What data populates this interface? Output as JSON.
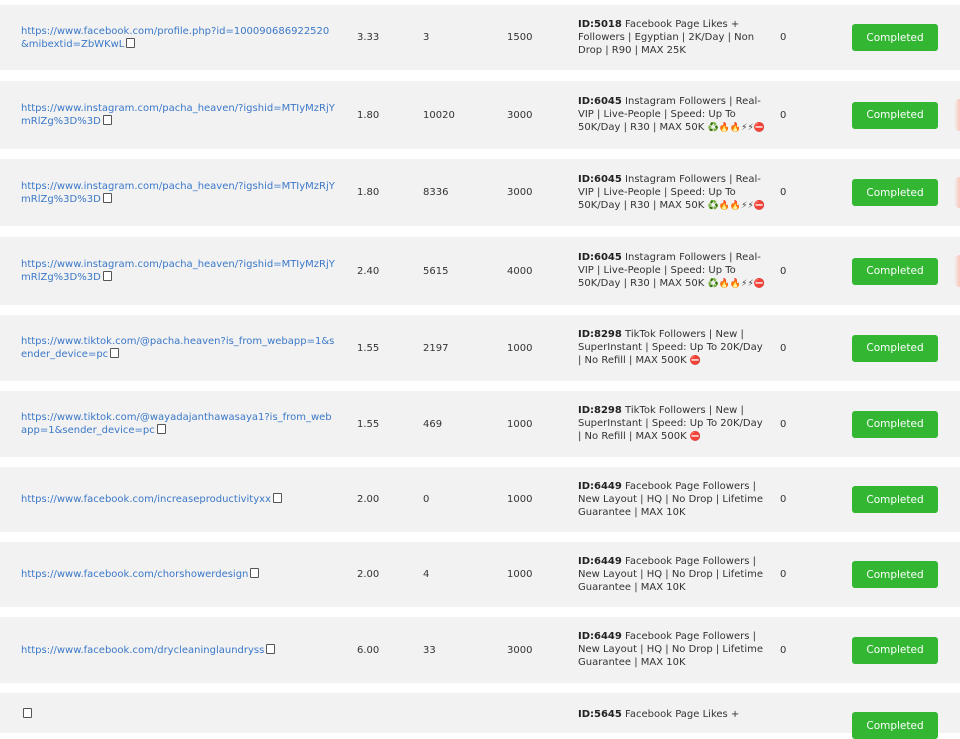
{
  "orders": [
    {
      "link": "https://www.facebook.com/profile.php?id=100090686922520&mibextid=ZbWKwL",
      "charge": "3.33",
      "start_count": "3",
      "quantity": "1500",
      "service_id": "ID:5018",
      "service": "Facebook Page Likes + Followers | Egyptian | 2K/Day | Non Drop | R90 | MAX 25K",
      "service_emoji": "",
      "remains": "0",
      "status": "Completed"
    },
    {
      "link": "https://www.instagram.com/pacha_heaven/?igshid=MTIyMzRjYmRlZg%3D%3D",
      "charge": "1.80",
      "start_count": "10020",
      "quantity": "3000",
      "service_id": "ID:6045",
      "service": "Instagram Followers | Real-VIP | Live-People | Speed: Up To 50K/Day | R30 | MAX 50K",
      "service_emoji": "♻️🔥🔥⚡⚡⛔",
      "remains": "0",
      "status": "Completed"
    },
    {
      "link": "https://www.instagram.com/pacha_heaven/?igshid=MTIyMzRjYmRlZg%3D%3D",
      "charge": "1.80",
      "start_count": "8336",
      "quantity": "3000",
      "service_id": "ID:6045",
      "service": "Instagram Followers | Real-VIP | Live-People | Speed: Up To 50K/Day | R30 | MAX 50K",
      "service_emoji": "♻️🔥🔥⚡⚡⛔",
      "remains": "0",
      "status": "Completed"
    },
    {
      "link": "https://www.instagram.com/pacha_heaven/?igshid=MTIyMzRjYmRlZg%3D%3D",
      "charge": "2.40",
      "start_count": "5615",
      "quantity": "4000",
      "service_id": "ID:6045",
      "service": "Instagram Followers | Real-VIP | Live-People | Speed: Up To 50K/Day | R30 | MAX 50K",
      "service_emoji": "♻️🔥🔥⚡⚡⛔",
      "remains": "0",
      "status": "Completed"
    },
    {
      "link": "https://www.tiktok.com/@pacha.heaven?is_from_webapp=1&sender_device=pc",
      "charge": "1.55",
      "start_count": "2197",
      "quantity": "1000",
      "service_id": "ID:8298",
      "service": "TikTok Followers | New | SuperInstant | Speed: Up To 20K/Day | No Refill | MAX 500K",
      "service_emoji": "⛔",
      "remains": "0",
      "status": "Completed"
    },
    {
      "link": "https://www.tiktok.com/@wayadajanthawasaya1?is_from_webapp=1&sender_device=pc",
      "charge": "1.55",
      "start_count": "469",
      "quantity": "1000",
      "service_id": "ID:8298",
      "service": "TikTok Followers | New | SuperInstant | Speed: Up To 20K/Day | No Refill | MAX 500K",
      "service_emoji": "⛔",
      "remains": "0",
      "status": "Completed"
    },
    {
      "link": "https://www.facebook.com/increaseproductivityxx",
      "charge": "2.00",
      "start_count": "0",
      "quantity": "1000",
      "service_id": "ID:6449",
      "service": "Facebook Page Followers | New Layout | HQ | No Drop | Lifetime Guarantee | MAX 10K",
      "service_emoji": "",
      "remains": "0",
      "status": "Completed"
    },
    {
      "link": "https://www.facebook.com/chorshowerdesign",
      "charge": "2.00",
      "start_count": "4",
      "quantity": "1000",
      "service_id": "ID:6449",
      "service": "Facebook Page Followers | New Layout | HQ | No Drop | Lifetime Guarantee | MAX 10K",
      "service_emoji": "",
      "remains": "0",
      "status": "Completed"
    },
    {
      "link": "https://www.facebook.com/drycleaninglaundryss",
      "charge": "6.00",
      "start_count": "33",
      "quantity": "3000",
      "service_id": "ID:6449",
      "service": "Facebook Page Followers | New Layout | HQ | No Drop | Lifetime Guarantee | MAX 10K",
      "service_emoji": "",
      "remains": "0",
      "status": "Completed"
    },
    {
      "link": "",
      "charge": "",
      "start_count": "",
      "quantity": "",
      "service_id": "ID:5645",
      "service": "Facebook Page Likes +",
      "service_emoji": "",
      "remains": "",
      "status": "Completed"
    }
  ],
  "icons": {
    "copy": "copy-icon"
  },
  "colors": {
    "status_completed": "#33b733",
    "link": "#3b78c8",
    "row_bg": "#f2f2f2"
  }
}
